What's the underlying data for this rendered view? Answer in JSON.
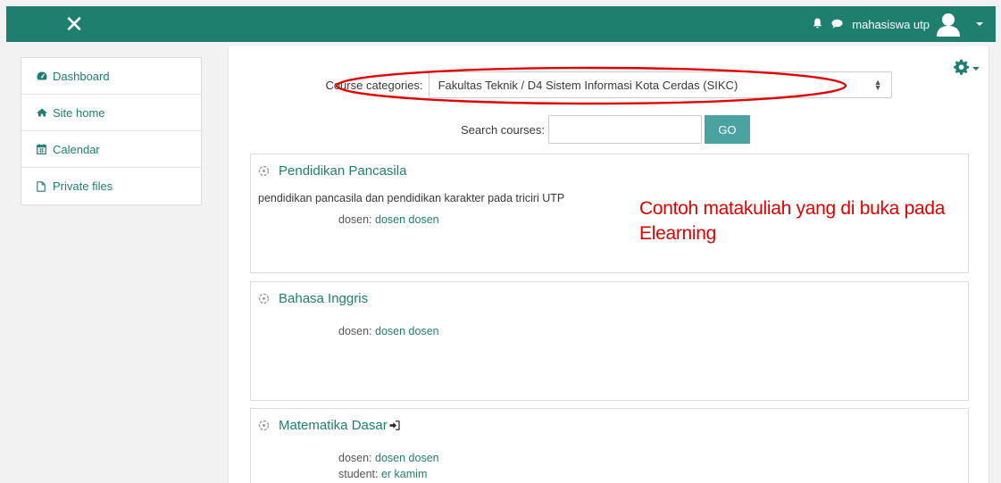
{
  "nav": {
    "username": "mahasiswa utp",
    "brand_color": "#1f7f6f"
  },
  "sidebar": {
    "items": [
      {
        "label": "Dashboard",
        "icon": "tachometer-icon"
      },
      {
        "label": "Site home",
        "icon": "home-icon"
      },
      {
        "label": "Calendar",
        "icon": "calendar-icon"
      },
      {
        "label": "Private files",
        "icon": "file-icon"
      }
    ]
  },
  "main": {
    "category_label": "Course categories:",
    "category_value": "Fakultas Teknik / D4 Sistem Informasi Kota Cerdas (SIKC)",
    "search_label": "Search courses:",
    "search_value": "",
    "go_label": "GO",
    "courses": [
      {
        "title": "Pendidikan Pancasila",
        "summary": "pendidikan pancasila dan pendidikan karakter pada triciri UTP",
        "teachers": [
          {
            "role": "dosen:",
            "name": "dosen dosen"
          }
        ]
      },
      {
        "title": "Bahasa Inggris",
        "summary": "",
        "teachers": [
          {
            "role": "dosen:",
            "name": "dosen dosen"
          }
        ]
      },
      {
        "title": "Matematika Dasar",
        "summary": "",
        "teachers": [
          {
            "role": "dosen:",
            "name": "dosen dosen"
          },
          {
            "role": "student:",
            "name": "er kamim"
          }
        ],
        "self_enrol": true
      }
    ]
  },
  "annotation": {
    "text_line1": "Contoh matakuliah yang di buka pada",
    "text_line2": "Elearning",
    "color": "#e00000"
  }
}
